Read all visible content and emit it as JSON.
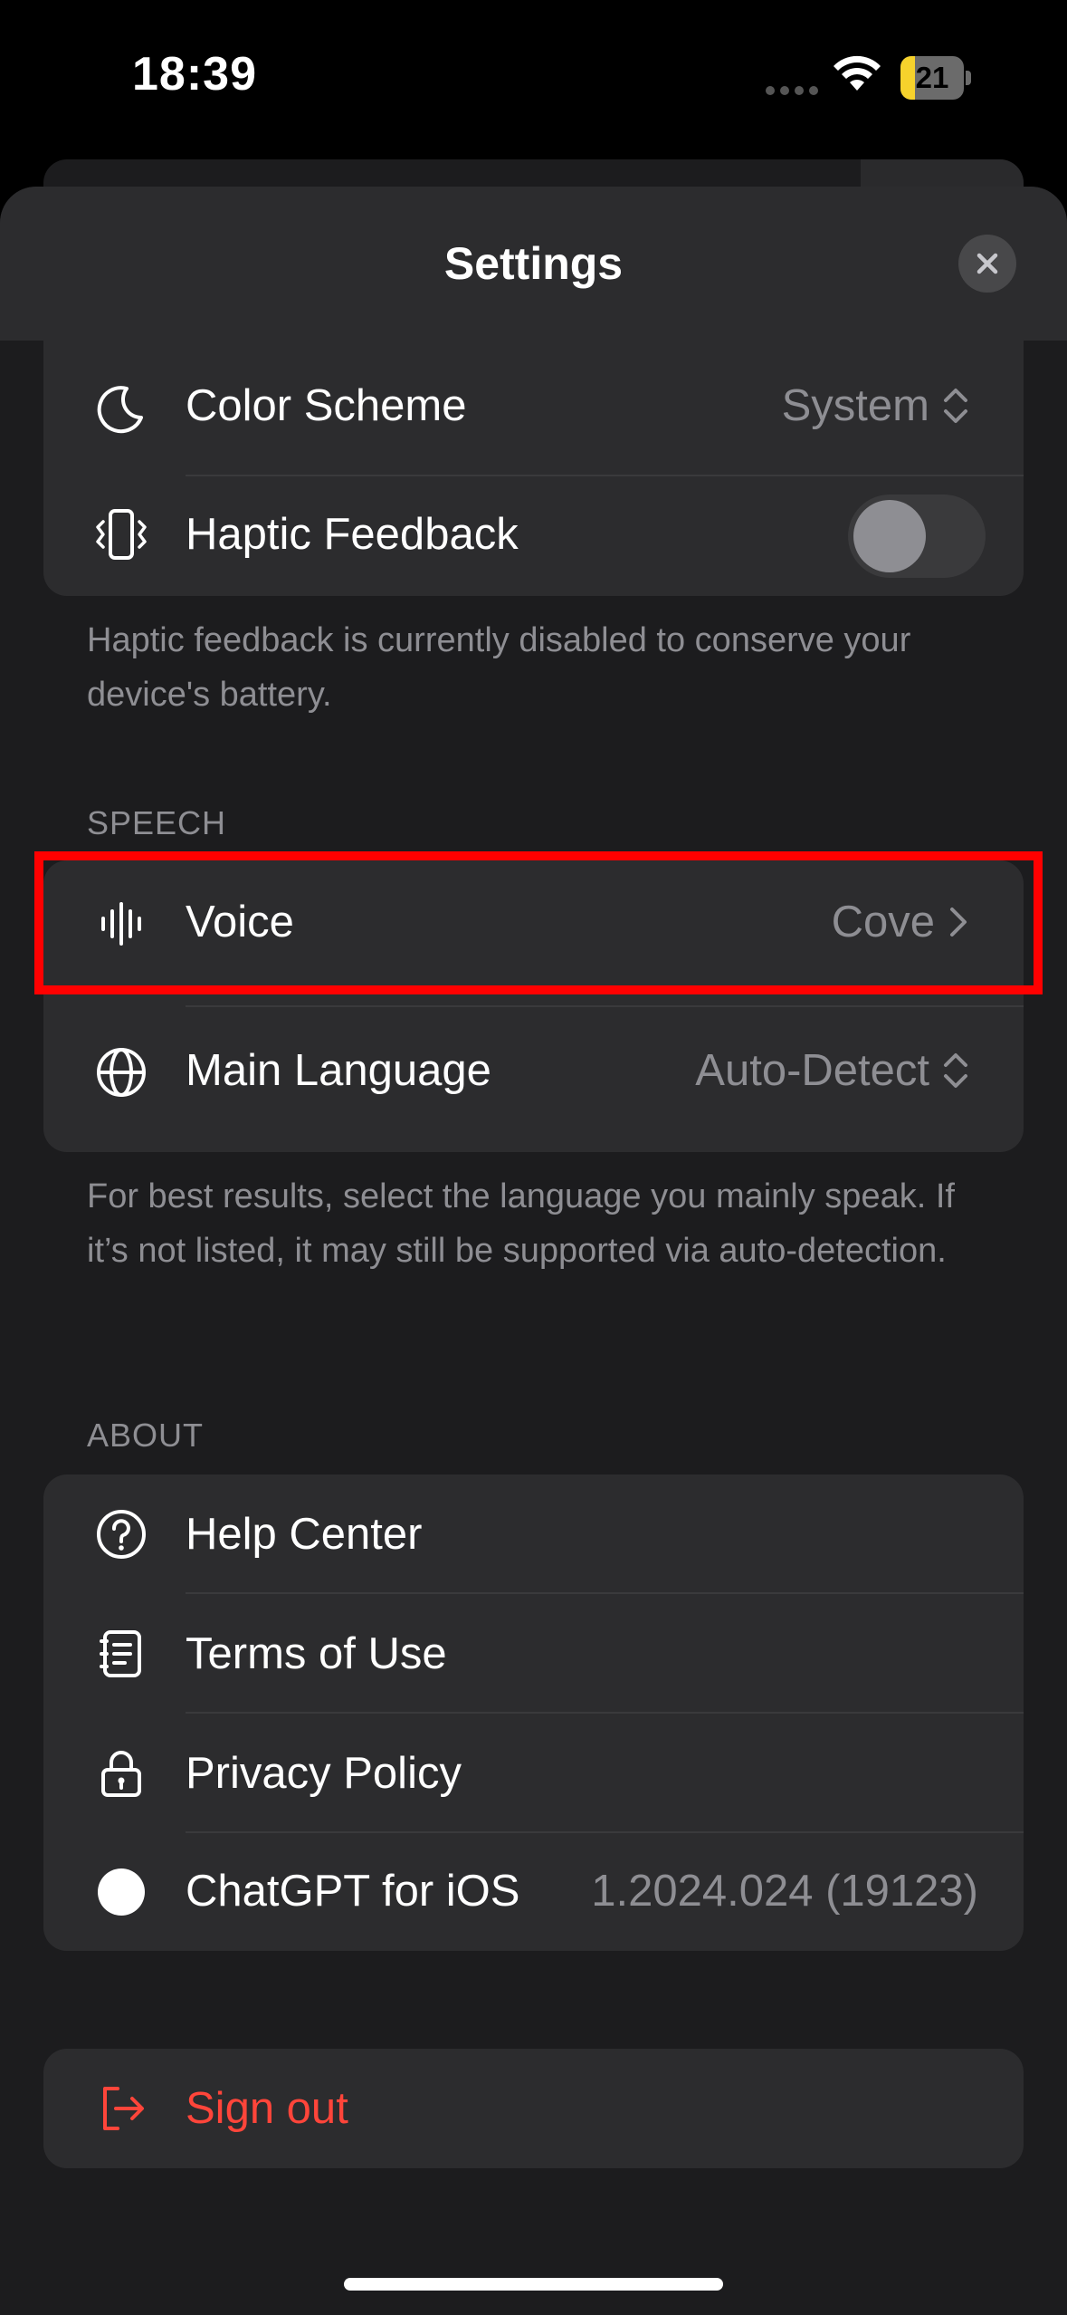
{
  "status_bar": {
    "time": "18:39",
    "battery_level": "21"
  },
  "header": {
    "title": "Settings"
  },
  "appearance": {
    "color_scheme_label": "Color Scheme",
    "color_scheme_value": "System",
    "haptic_label": "Haptic Feedback",
    "haptic_enabled": false,
    "haptic_footnote": "Haptic feedback is currently disabled to conserve your device's battery."
  },
  "speech": {
    "section_title": "SPEECH",
    "voice_label": "Voice",
    "voice_value": "Cove",
    "language_label": "Main Language",
    "language_value": "Auto-Detect",
    "footnote": "For best results, select the language you mainly speak. If it’s not listed, it may still be supported via auto-detection."
  },
  "about": {
    "section_title": "ABOUT",
    "help_label": "Help Center",
    "terms_label": "Terms of Use",
    "privacy_label": "Privacy Policy",
    "app_label": "ChatGPT for iOS",
    "app_version": "1.2024.024 (19123)"
  },
  "account": {
    "sign_out_label": "Sign out"
  },
  "colors": {
    "background": "#000000",
    "sheet": "#1c1c1e",
    "group": "#2c2c2e",
    "secondary_text": "#8e8e93",
    "destructive": "#ff453a",
    "highlight": "#ff0000"
  },
  "icons": {
    "color_scheme": "moon-icon",
    "haptic": "haptic-phone-icon",
    "voice": "waveform-icon",
    "language": "globe-icon",
    "help": "question-circle-icon",
    "terms": "document-icon",
    "privacy": "lock-icon",
    "app": "filled-circle-icon",
    "sign_out": "sign-out-icon",
    "close": "close-icon"
  }
}
